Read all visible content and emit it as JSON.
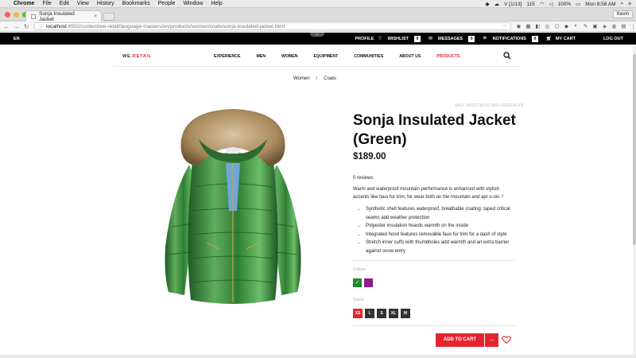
{
  "menubar": {
    "app": "Chrome",
    "items": [
      "File",
      "Edit",
      "View",
      "History",
      "Bookmarks",
      "People",
      "Window",
      "Help"
    ],
    "status": {
      "extras": "V [1/13]",
      "count": "115",
      "battery": "100%",
      "clock": "Mon 8:58 AM"
    }
  },
  "browser": {
    "tab_title": "Sonja Insulated Jacket",
    "user": "Kevin",
    "url_host": "localhost",
    "url_path": ":4502/content/we-retail/language-masters/en/products/women/coats/sonja-insulated-jacket.html"
  },
  "topbar": {
    "language": "EN",
    "profile": "PROFILE",
    "wishlist": "WISHLIST",
    "wishlist_count": "0",
    "messages": "MESSAGES",
    "messages_count": "0",
    "notifications": "NOTIFICATIONS",
    "notifications_count": "0",
    "cart": "MY CART",
    "logout": "LOG OUT"
  },
  "site": {
    "logo_a": "WE.",
    "logo_b": "RETAIL",
    "nav": [
      "EXPERIENCE",
      "MEN",
      "WOMEN",
      "EQUIPMENT",
      "COMMUNITIES",
      "ABOUT US",
      "PRODUCTS"
    ],
    "active_nav": "PRODUCTS"
  },
  "breadcrumb": {
    "level1": "Women",
    "separator": "/",
    "level2": "Coats"
  },
  "product": {
    "sku": "SKU: WOSTWOSTWO-GREEN-XS",
    "title": "Sonja Insulated Jacket (Green)",
    "price": "$189.00",
    "reviews": "0 reviews",
    "description": "Warm and waterproof mountain performance is enhanced with stylish accents like faux fur trim, for wear both on the mountain and apr s-ski. ³",
    "features": [
      "Synthetic shell features waterproof, breathable coating; taped critical seams add weather protection",
      "Polyester insulation hoards warmth on the inside",
      "Integrated hood features removable faux fur trim for a dash of style",
      "Stretch inner cuffs with thumbholes add warmth and an extra barrier against snow entry"
    ],
    "colors_label": "Colors",
    "colors": [
      {
        "hex": "#1f8a2c",
        "selected": true,
        "check": "✓"
      },
      {
        "hex": "#8b1e8e",
        "selected": false,
        "check": ""
      }
    ],
    "sizes_label": "Sizes",
    "sizes": [
      "XS",
      "L",
      "S",
      "XL",
      "M"
    ],
    "selected_size": "XS",
    "add_to_cart": "ADD TO CART"
  },
  "colors": {
    "brand_red": "#e3262e",
    "jacket_green": "#2f7d32"
  }
}
